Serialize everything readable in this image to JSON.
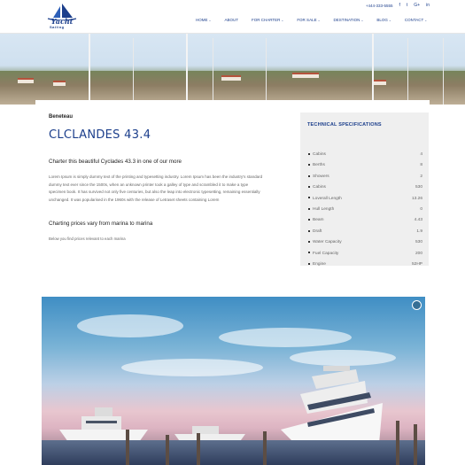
{
  "header": {
    "logo_text": "Yacht",
    "logo_sub": "Sailing",
    "phone": "+444-333-5555",
    "social": [
      "f",
      "t",
      "G+",
      "in"
    ],
    "nav": [
      {
        "label": "HOME",
        "chevron": true
      },
      {
        "label": "ABOUT",
        "chevron": false
      },
      {
        "label": "FOR CHARTER",
        "chevron": true
      },
      {
        "label": "FOR SALE",
        "chevron": true
      },
      {
        "label": "DESTINATION",
        "chevron": true
      },
      {
        "label": "BLOG",
        "chevron": true
      },
      {
        "label": "CONTACT",
        "chevron": true
      }
    ]
  },
  "content": {
    "subtitle": "Beneteau",
    "title": "CLCLANDES 43.4",
    "intro": "Charter this beautiful Cyclades 43.3 in one of our more",
    "paragraph": "Lorem Ipsum is simply dummy text of the printing and typesetting industry. Lorem Ipsum has been the industry's standard dummy text ever since the 1500s, when an unknown printer took a galley of type and scrambled it to make a type specimen book. It has survived not only five centuries, but also the leap into electronic typesetting, remaining essentially unchanged. It was popularised in the 1960s with the release of Letraset sheets containing Lorem",
    "section_title": "Charting prices vary from marina to marina",
    "note": "Below you find prices relevant to each marina"
  },
  "specs": {
    "title": "TECHNICAL SPECIFICATIONS",
    "rows": [
      {
        "label": "Cabins",
        "value": "4"
      },
      {
        "label": "Berths",
        "value": "8"
      },
      {
        "label": "Showers",
        "value": "2"
      },
      {
        "label": "Cabins",
        "value": "530"
      },
      {
        "label": "Loverall Length",
        "value": "13.26"
      },
      {
        "label": "Hull Length",
        "value": "0"
      },
      {
        "label": "Beam",
        "value": "4.43"
      },
      {
        "label": "Draft",
        "value": "1.9"
      },
      {
        "label": "Water Capacity",
        "value": "530"
      },
      {
        "label": "Fuel Capacity",
        "value": "200"
      },
      {
        "label": "Engine",
        "value": "52HP"
      }
    ]
  },
  "colors": {
    "brand": "#1c3f8c",
    "spec_bg": "#efefef"
  }
}
